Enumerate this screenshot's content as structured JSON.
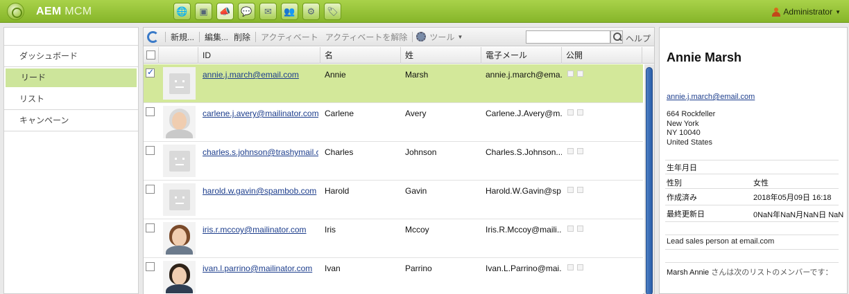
{
  "app": {
    "brand_bold": "AEM",
    "brand_light": "MCM"
  },
  "user": {
    "name": "Administrator"
  },
  "top_icons": [
    "globe-icon",
    "camera-icon",
    "megaphone-icon",
    "speech-bubble-icon",
    "mail-icon",
    "people-icon",
    "gear-icon",
    "tag-icon"
  ],
  "nav": {
    "items": [
      {
        "label": "ダッシュボード"
      },
      {
        "label": "リード"
      },
      {
        "label": "リスト"
      },
      {
        "label": "キャンペーン"
      }
    ]
  },
  "toolbar": {
    "new": "新規...",
    "edit": "編集...",
    "delete": "削除",
    "activate": "アクティベート",
    "deactivate": "アクティベートを解除",
    "tools": "ツール",
    "help": "ヘルプ",
    "search_value": ""
  },
  "columns": {
    "id": "ID",
    "first": "名",
    "last": "姓",
    "email": "電子メール",
    "public": "公開"
  },
  "rows": [
    {
      "id": "annie.j.march@email.com",
      "first": "Annie",
      "last": "Marsh",
      "email": "annie.j.march@ema...",
      "avatar": "placeholder",
      "checked": true
    },
    {
      "id": "carlene.j.avery@mailinator.com",
      "first": "Carlene",
      "last": "Avery",
      "email": "Carlene.J.Avery@m...",
      "avatar": "woman-gray",
      "checked": false
    },
    {
      "id": "charles.s.johnson@trashymail.c...",
      "first": "Charles",
      "last": "Johnson",
      "email": "Charles.S.Johnson...",
      "avatar": "placeholder",
      "checked": false
    },
    {
      "id": "harold.w.gavin@spambob.com",
      "first": "Harold",
      "last": "Gavin",
      "email": "Harold.W.Gavin@sp...",
      "avatar": "placeholder",
      "checked": false
    },
    {
      "id": "iris.r.mccoy@mailinator.com",
      "first": "Iris",
      "last": "Mccoy",
      "email": "Iris.R.Mccoy@maili...",
      "avatar": "woman-brown",
      "checked": false
    },
    {
      "id": "ivan.l.parrino@mailinator.com",
      "first": "Ivan",
      "last": "Parrino",
      "email": "Ivan.L.Parrino@mai...",
      "avatar": "man-dark",
      "checked": false
    }
  ],
  "detail": {
    "name": "Annie Marsh",
    "email": "annie.j.march@email.com",
    "address": [
      "664 Rockfeller",
      "New York",
      "NY 10040",
      "United States"
    ],
    "birthday_label": "生年月日",
    "gender_label": "性別",
    "gender_value": "女性",
    "created_label": "作成済み",
    "created_value": "2018年05月09日 16:18",
    "modified_label": "最終更新日",
    "modified_value": "0NaN年NaN月NaN日 NaN",
    "note": "Lead sales person at email.com",
    "member_name": "Marsh Annie",
    "member_text": "さんは次のリストのメンバーです："
  }
}
